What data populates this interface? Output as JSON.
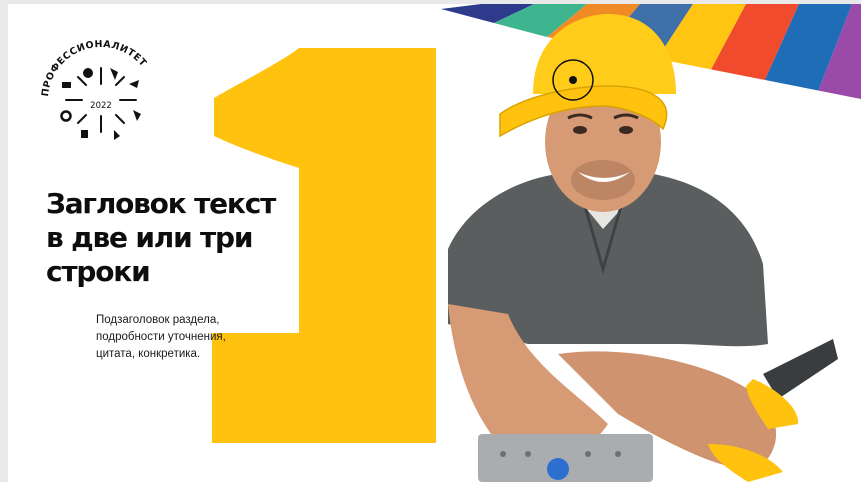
{
  "slide": {
    "number": "1",
    "logo": {
      "arc_text": "ПРОФЕССИОНАЛИТЕТ",
      "year": "2022"
    },
    "title_lines": [
      "Загловок текст",
      "в две или три",
      "строки"
    ],
    "subtitle_lines": [
      "Подзаголовок раздела,",
      "подробности уточнения,",
      "цитата, конкретика."
    ],
    "stripe_colors": [
      "#2e3a8c",
      "#3fb58f",
      "#f08a24",
      "#3e6fa8",
      "#ffc512",
      "#ef4b2c",
      "#1f6cb7",
      "#9a4aa8"
    ],
    "accent_color": "#ffc20e"
  }
}
